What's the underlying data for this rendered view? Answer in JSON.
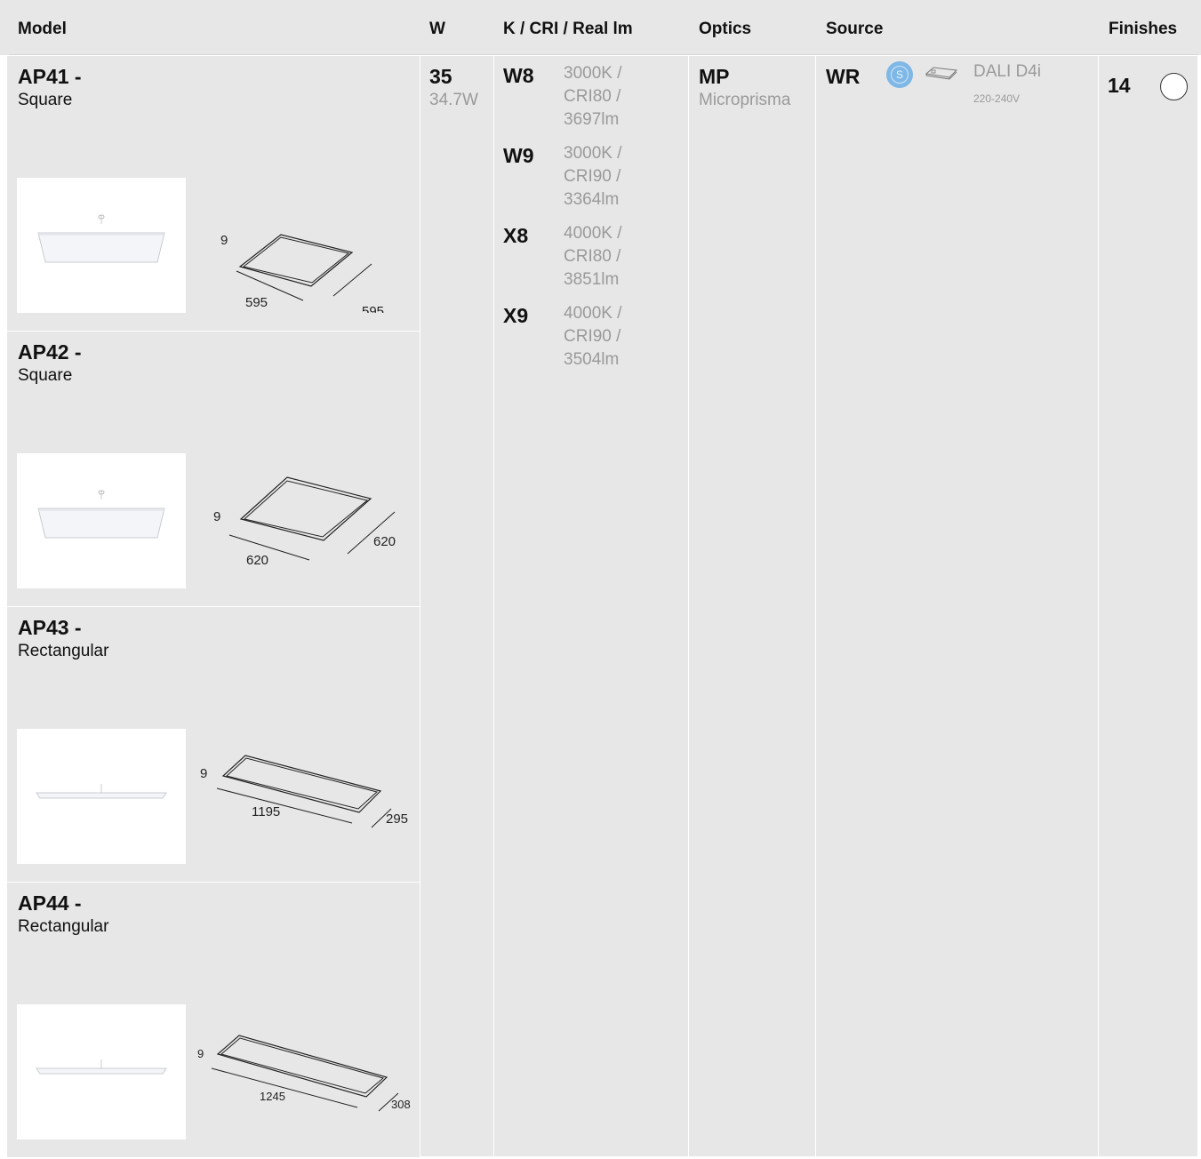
{
  "header": {
    "model": "Model",
    "w": "W",
    "k_cri": "K / CRI / Real lm",
    "optics": "Optics",
    "source": "Source",
    "finishes": "Finishes"
  },
  "models": [
    {
      "code": "AP41 -",
      "shape": "Square",
      "dims": {
        "height": "9",
        "a": "595",
        "b": "595"
      }
    },
    {
      "code": "AP42 -",
      "shape": "Square",
      "dims": {
        "height": "9",
        "a": "620",
        "b": "620"
      }
    },
    {
      "code": "AP43 -",
      "shape": "Rectangular",
      "dims": {
        "height": "9",
        "a": "1195",
        "b": "295"
      }
    },
    {
      "code": "AP44 -",
      "shape": "Rectangular",
      "dims": {
        "height": "9",
        "a": "1245",
        "b": "308"
      }
    }
  ],
  "power": {
    "code": "35",
    "value": "34.7W"
  },
  "lumens": [
    {
      "code": "W8",
      "lines": [
        "3000K /",
        "CRI80 /",
        "3697lm"
      ]
    },
    {
      "code": "W9",
      "lines": [
        "3000K /",
        "CRI90 /",
        "3364lm"
      ]
    },
    {
      "code": "X8",
      "lines": [
        "4000K /",
        "CRI80 /",
        "3851lm"
      ]
    },
    {
      "code": "X9",
      "lines": [
        "4000K /",
        "CRI90 /",
        "3504lm"
      ]
    }
  ],
  "optics": {
    "code": "MP",
    "name": "Microprisma"
  },
  "source": {
    "code": "WR",
    "badge_letter": "S",
    "badge_icon": "smart-s-badge-icon",
    "driver_icon": "driver-box-icon",
    "driver": "DALI D4i",
    "voltage": "220-240V"
  },
  "finishes": {
    "code": "14",
    "swatch_color": "#ffffff"
  },
  "colors": {
    "panel": "#e7e7e7",
    "badge": "#7fb8e6",
    "muted": "#9a9a9a"
  }
}
